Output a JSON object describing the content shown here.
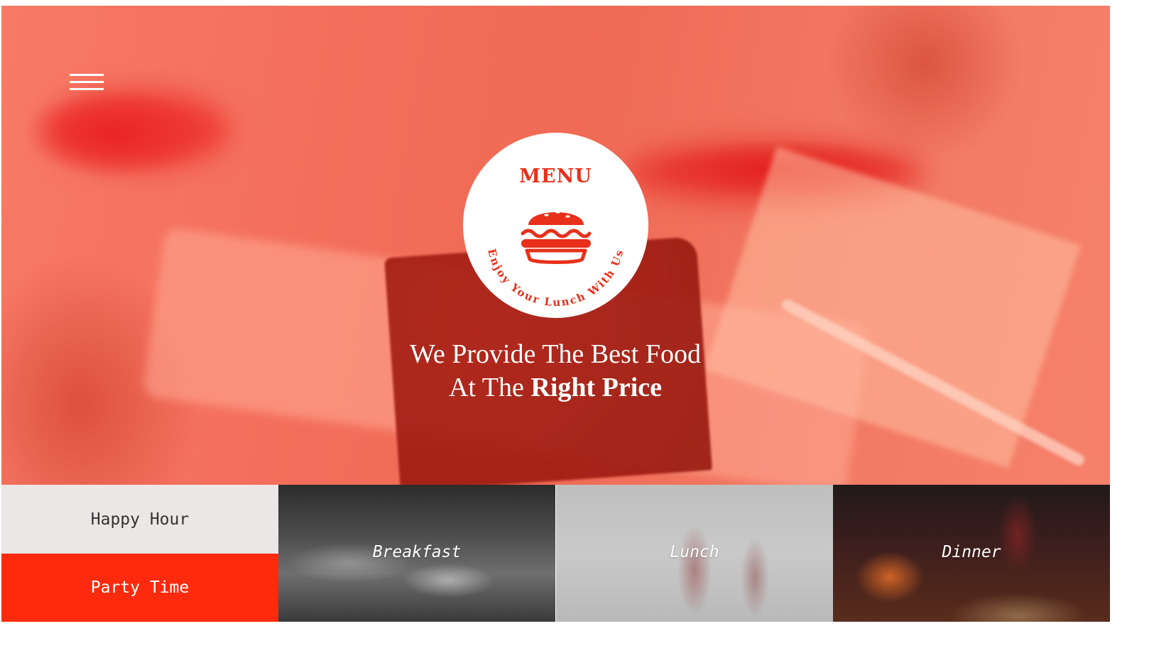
{
  "nav": {
    "menu_icon": "hamburger-icon"
  },
  "badge": {
    "title": "MENU",
    "icon": "burger-icon",
    "ring_text": "Enjoy Your Lunch With Us",
    "accent_color": "#e8301a"
  },
  "hero": {
    "headline_line1": "We Provide The Best Food",
    "headline_line2_prefix": "At The ",
    "headline_line2_bold": "Right Price",
    "overlay_color": "#f4705c"
  },
  "tiles": {
    "happy_hour": "Happy Hour",
    "party_time": "Party Time",
    "breakfast": "Breakfast",
    "lunch": "Lunch",
    "dinner": "Dinner",
    "party_color": "#fd2a0d",
    "happy_color": "#ebe7e6"
  }
}
